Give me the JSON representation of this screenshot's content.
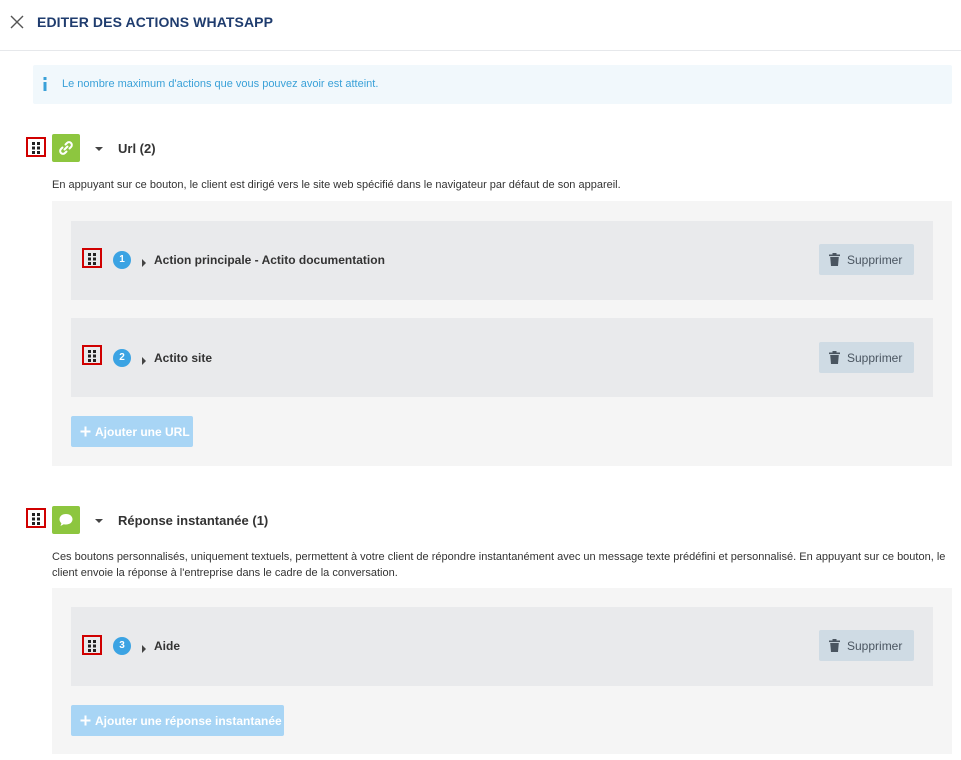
{
  "header": {
    "title": "EDITER DES ACTIONS WHATSAPP",
    "close_icon": "close-icon"
  },
  "info": {
    "icon": "info-icon",
    "text": "Le nombre maximum d'actions que vous pouvez avoir est atteint."
  },
  "sections": [
    {
      "icon": "link-icon",
      "icon_color": "#8dc63f",
      "title": "Url (2)",
      "description": "En appuyant sur ce bouton, le client est dirigé vers le site web spécifié dans le navigateur par défaut de son appareil.",
      "actions": [
        {
          "number": "1",
          "label": "Action principale - Actito documentation",
          "delete_label": "Supprimer"
        },
        {
          "number": "2",
          "label": "Actito site",
          "delete_label": "Supprimer"
        }
      ],
      "add_label": "Ajouter une URL"
    },
    {
      "icon": "chat-bubble-icon",
      "icon_color": "#8dc63f",
      "title": "Réponse instantanée (1)",
      "description": "Ces boutons personnalisés, uniquement textuels, permettent à votre client de répondre instantanément avec un message texte prédéfini et personnalisé. En appuyant sur ce bouton, le client envoie la réponse à l'entreprise dans le cadre de la conversation.",
      "actions": [
        {
          "number": "3",
          "label": "Aide",
          "delete_label": "Supprimer"
        }
      ],
      "add_label": "Ajouter une réponse instantanée"
    }
  ],
  "colors": {
    "title_blue": "#1f3c6e",
    "info_blue": "#3aa1d8",
    "badge_blue": "#3ba3e3",
    "add_button": "#a8d5f5",
    "delete_button": "#cfdbe4",
    "drag_highlight": "#d00000"
  }
}
